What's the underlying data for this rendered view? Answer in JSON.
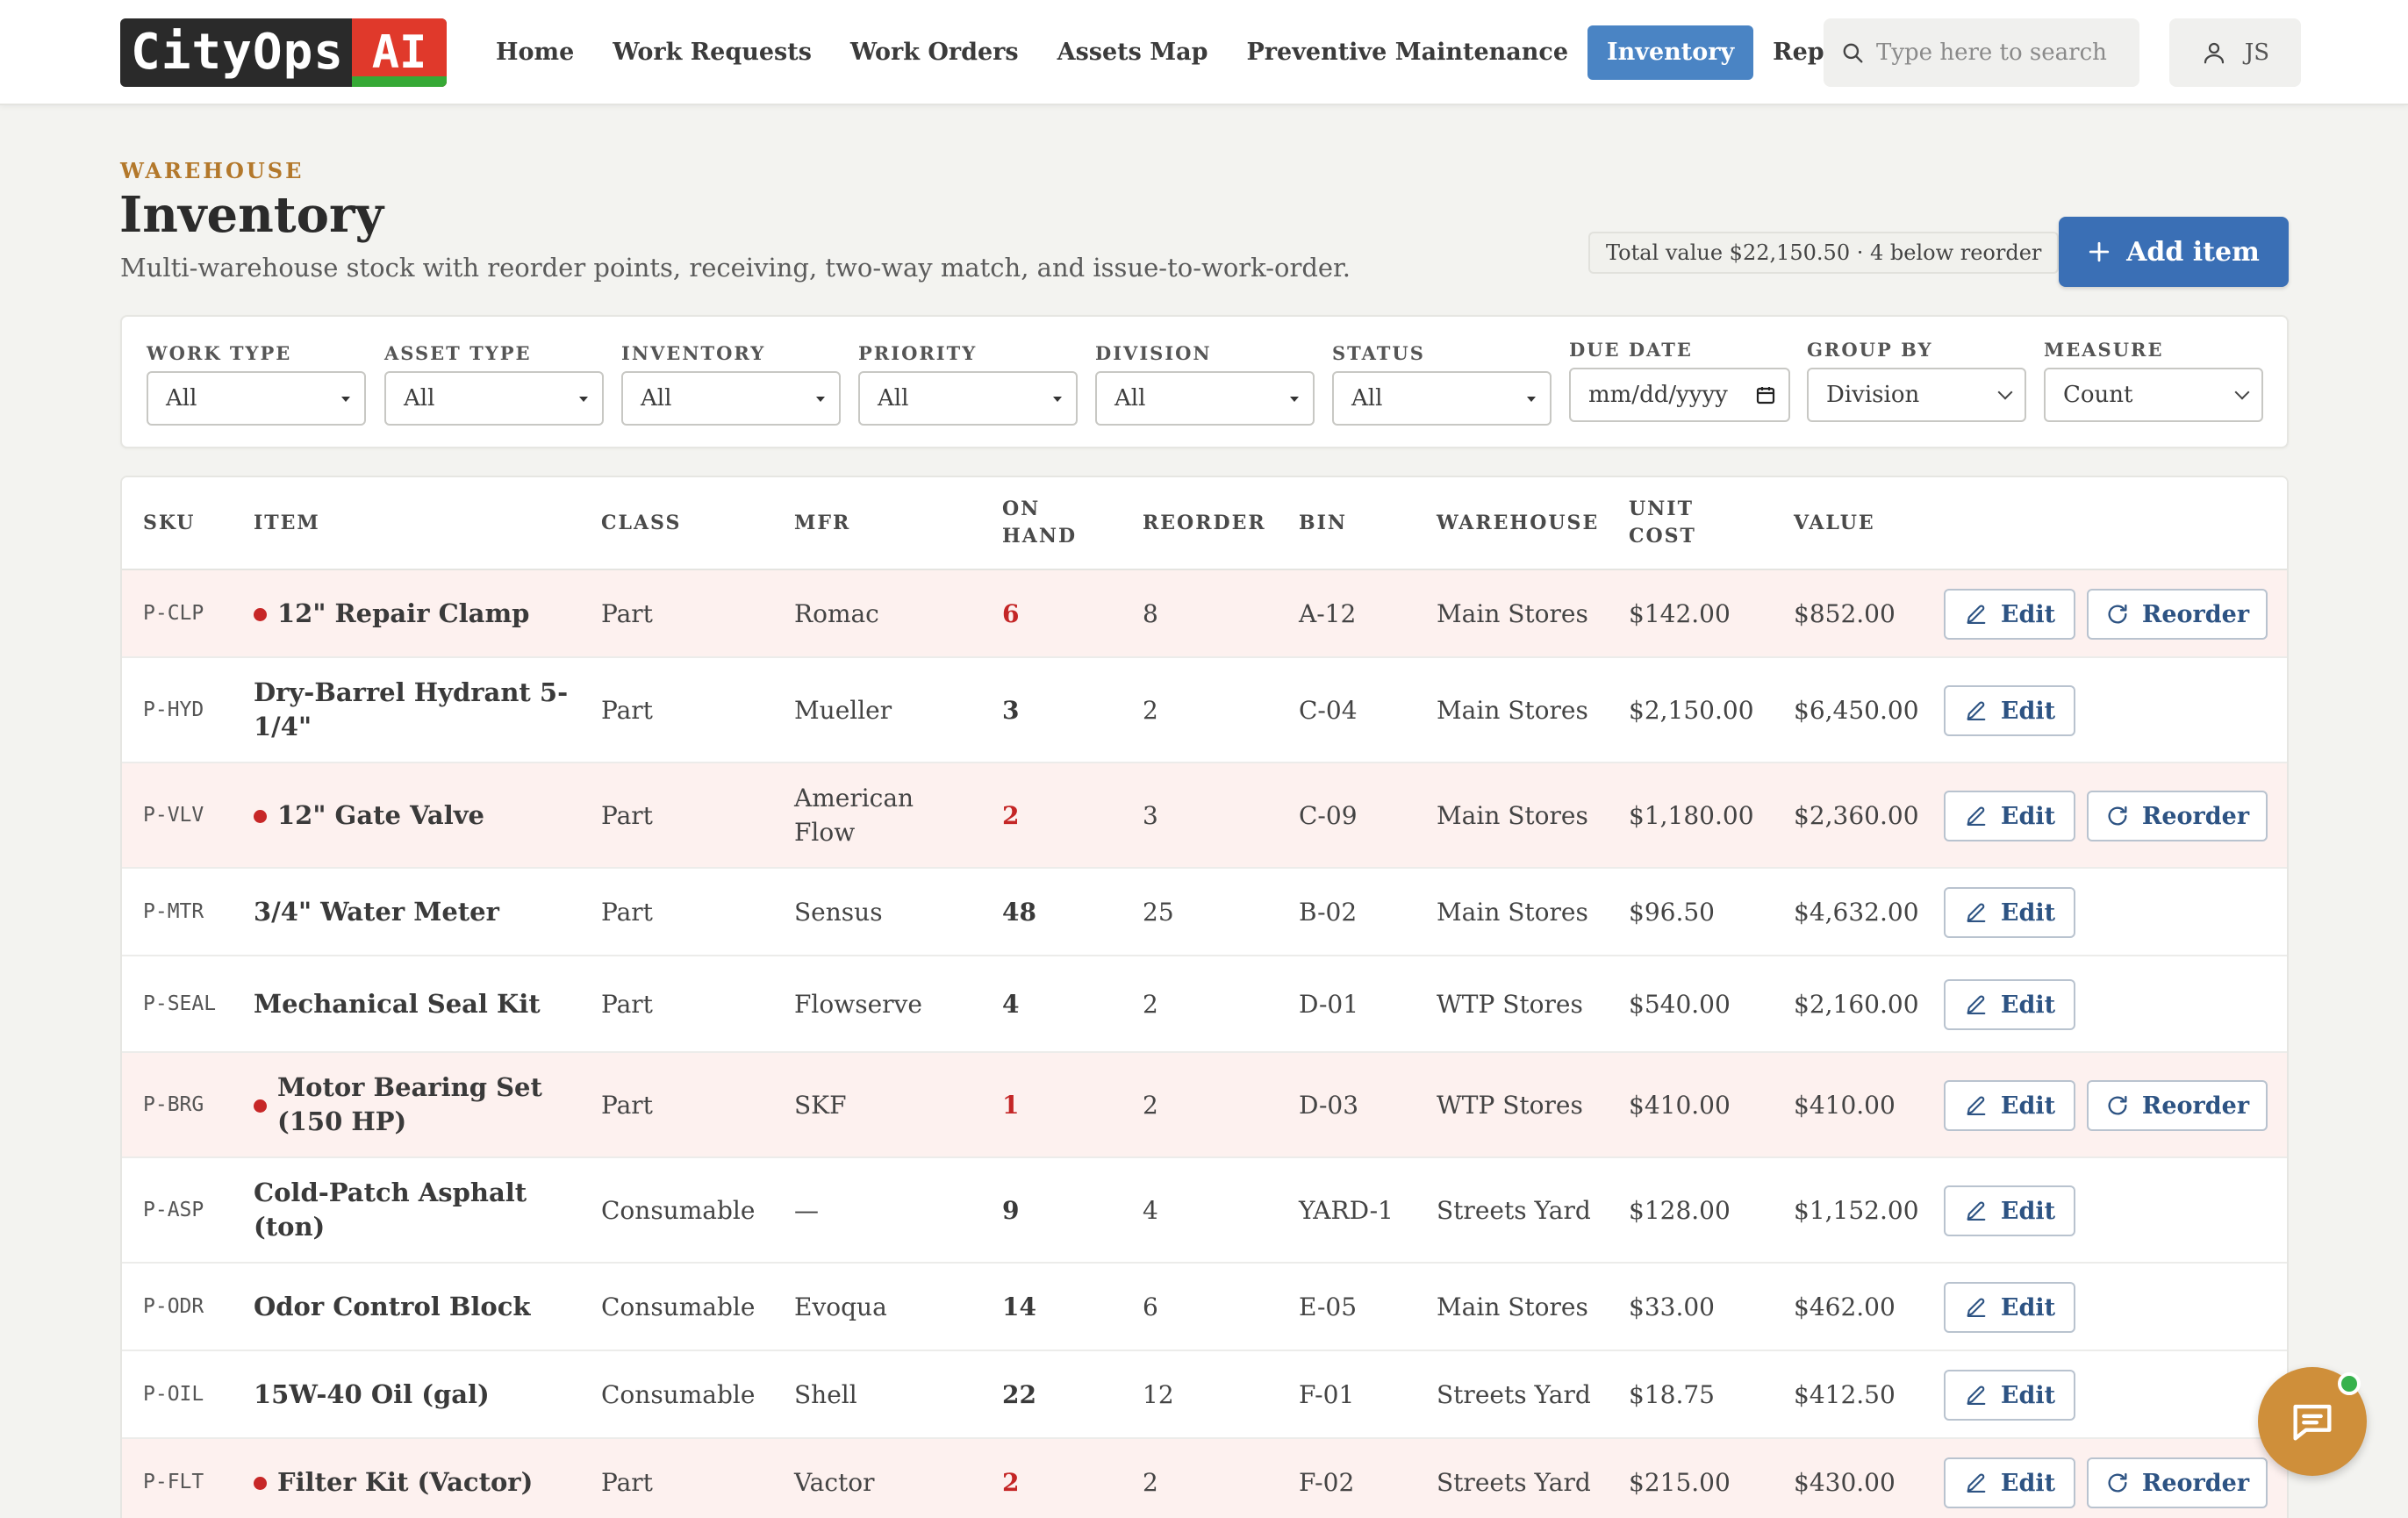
{
  "brand": {
    "name_main": "CityOps",
    "name_ai": "AI"
  },
  "nav": {
    "items": [
      {
        "label": "Home"
      },
      {
        "label": "Work Requests"
      },
      {
        "label": "Work Orders"
      },
      {
        "label": "Assets Map"
      },
      {
        "label": "Preventive Maintenance"
      },
      {
        "label": "Inventory",
        "active": true
      },
      {
        "label": "Reports"
      }
    ],
    "search_placeholder": "Type here to search",
    "user_initials": "JS"
  },
  "header": {
    "eyebrow": "WAREHOUSE",
    "title": "Inventory",
    "subtitle": "Multi-warehouse stock with reorder points, receiving, two-way match, and issue-to-work-order.",
    "total_summary": "Total value $22,150.50 · 4 below reorder",
    "add_button": "Add item"
  },
  "filters": {
    "work_type": {
      "label": "WORK TYPE",
      "value": "All"
    },
    "asset_type": {
      "label": "ASSET TYPE",
      "value": "All"
    },
    "inventory": {
      "label": "INVENTORY",
      "value": "All"
    },
    "priority": {
      "label": "PRIORITY",
      "value": "All"
    },
    "division": {
      "label": "DIVISION",
      "value": "All"
    },
    "status": {
      "label": "STATUS",
      "value": "All"
    },
    "due_date": {
      "label": "DUE DATE",
      "placeholder": "mm/dd/yyyy"
    },
    "group_by": {
      "label": "GROUP BY",
      "value": "Division"
    },
    "measure": {
      "label": "MEASURE",
      "value": "Count"
    }
  },
  "table": {
    "columns": {
      "sku": "SKU",
      "item": "ITEM",
      "class": "CLASS",
      "mfr": "MFR",
      "on_hand_1": "ON",
      "on_hand_2": "HAND",
      "reorder": "REORDER",
      "bin": "BIN",
      "warehouse": "WAREHOUSE",
      "unit_cost_1": "UNIT",
      "unit_cost_2": "COST",
      "value": "VALUE"
    },
    "edit_label": "Edit",
    "reorder_label": "Reorder",
    "rows": [
      {
        "sku": "P-CLP",
        "item": "12\" Repair Clamp",
        "class": "Part",
        "mfr": "Romac",
        "on_hand": "6",
        "reorder": "8",
        "bin": "A-12",
        "warehouse": "Main Stores",
        "unit_cost": "$142.00",
        "value": "$852.00",
        "low": true
      },
      {
        "sku": "P-HYD",
        "item": "Dry-Barrel Hydrant 5-1/4\"",
        "class": "Part",
        "mfr": "Mueller",
        "on_hand": "3",
        "reorder": "2",
        "bin": "C-04",
        "warehouse": "Main Stores",
        "unit_cost": "$2,150.00",
        "value": "$6,450.00",
        "low": false
      },
      {
        "sku": "P-VLV",
        "item": "12\" Gate Valve",
        "class": "Part",
        "mfr": "American Flow",
        "on_hand": "2",
        "reorder": "3",
        "bin": "C-09",
        "warehouse": "Main Stores",
        "unit_cost": "$1,180.00",
        "value": "$2,360.00",
        "low": true
      },
      {
        "sku": "P-MTR",
        "item": "3/4\" Water Meter",
        "class": "Part",
        "mfr": "Sensus",
        "on_hand": "48",
        "reorder": "25",
        "bin": "B-02",
        "warehouse": "Main Stores",
        "unit_cost": "$96.50",
        "value": "$4,632.00",
        "low": false
      },
      {
        "sku": "P-SEAL",
        "item": "Mechanical Seal Kit",
        "class": "Part",
        "mfr": "Flowserve",
        "on_hand": "4",
        "reorder": "2",
        "bin": "D-01",
        "warehouse": "WTP Stores",
        "unit_cost": "$540.00",
        "value": "$2,160.00",
        "low": false
      },
      {
        "sku": "P-BRG",
        "item": "Motor Bearing Set (150 HP)",
        "class": "Part",
        "mfr": "SKF",
        "on_hand": "1",
        "reorder": "2",
        "bin": "D-03",
        "warehouse": "WTP Stores",
        "unit_cost": "$410.00",
        "value": "$410.00",
        "low": true
      },
      {
        "sku": "P-ASP",
        "item": "Cold-Patch Asphalt (ton)",
        "class": "Consumable",
        "mfr": "—",
        "on_hand": "9",
        "reorder": "4",
        "bin": "YARD-1",
        "warehouse": "Streets Yard",
        "unit_cost": "$128.00",
        "value": "$1,152.00",
        "low": false
      },
      {
        "sku": "P-ODR",
        "item": "Odor Control Block",
        "class": "Consumable",
        "mfr": "Evoqua",
        "on_hand": "14",
        "reorder": "6",
        "bin": "E-05",
        "warehouse": "Main Stores",
        "unit_cost": "$33.00",
        "value": "$462.00",
        "low": false
      },
      {
        "sku": "P-OIL",
        "item": "15W-40 Oil (gal)",
        "class": "Consumable",
        "mfr": "Shell",
        "on_hand": "22",
        "reorder": "12",
        "bin": "F-01",
        "warehouse": "Streets Yard",
        "unit_cost": "$18.75",
        "value": "$412.50",
        "low": false
      },
      {
        "sku": "P-FLT",
        "item": "Filter Kit (Vactor)",
        "class": "Part",
        "mfr": "Vactor",
        "on_hand": "2",
        "reorder": "2",
        "bin": "F-02",
        "warehouse": "Streets Yard",
        "unit_cost": "$215.00",
        "value": "$430.00",
        "low": true
      }
    ]
  },
  "colors": {
    "accent": "#3a6fb5",
    "nav_active": "#4a84c4",
    "alert": "#c42626",
    "alert_row": "#fdf1ef",
    "eyebrow": "#b3782b",
    "chat": "#cf8f3a"
  },
  "icons": {
    "search": "search-icon",
    "user": "user-icon",
    "add": "plus-icon",
    "edit": "pencil-icon",
    "reorder": "refresh-icon",
    "chat": "chat-icon",
    "calendar": "calendar-icon"
  }
}
